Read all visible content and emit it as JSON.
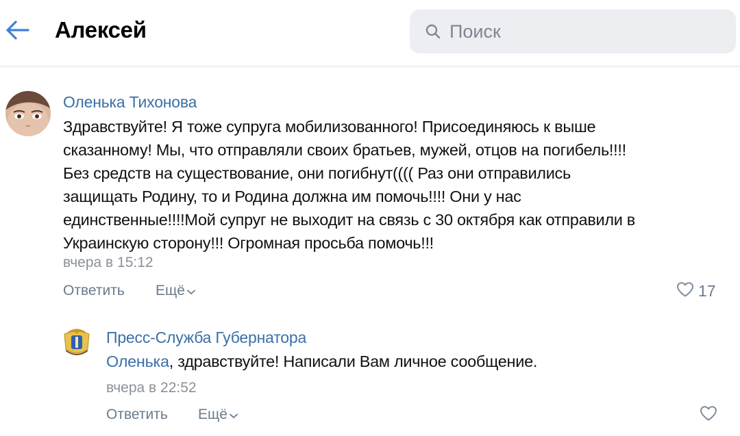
{
  "header": {
    "title": "Алексей",
    "search_placeholder": "Поиск"
  },
  "colors": {
    "link": "#3b6fa8",
    "action": "#6a7a8e",
    "time": "#8a9098",
    "search_bg": "#eceef2"
  },
  "comment": {
    "author": "Оленька Тихонова",
    "lines": [
      "Здравствуйте! Я тоже супруга мобилизованного! Присоединяюсь к выше",
      "сказанному! Мы, что отправляли своих братьев, мужей, отцов на погибель!!!!",
      "Без средств на существование, они погибнут(((( Раз они отправились",
      "защищать Родину, то и Родина должна им помочь!!!! Они у нас",
      "единственные!!!!Мой супруг не выходит на связь с 30 октября как отправили в",
      "Украинскую сторону!!! Огромная просьба помочь!!!"
    ],
    "time": "вчера в 15:12",
    "reply_label": "Ответить",
    "more_label": "Ещё",
    "likes": "17"
  },
  "reply": {
    "author": "Пресс-Служба Губернатора",
    "mention": "Оленька",
    "text": ", здравствуйте! Написали Вам личное сообщение.",
    "time": "вчера в 22:52",
    "reply_label": "Ответить",
    "more_label": "Ещё"
  },
  "icons": {
    "back": "arrow-left-icon",
    "search": "search-icon",
    "more": "chevron-down-icon",
    "like": "heart-icon",
    "reply_avatar": "coat-of-arms-icon"
  }
}
